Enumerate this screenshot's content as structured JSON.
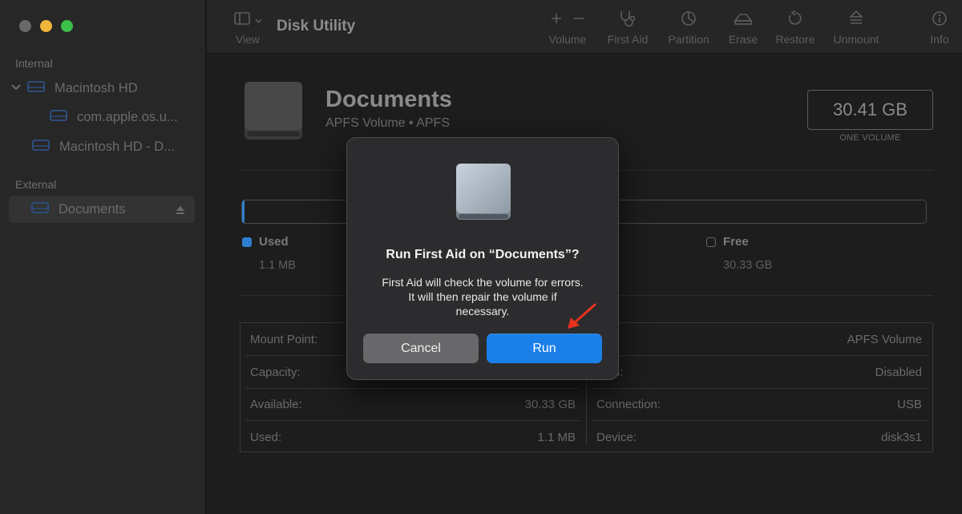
{
  "app": {
    "title": "Disk Utility"
  },
  "sidebar": {
    "sections": [
      {
        "label": "Internal"
      },
      {
        "label": "External"
      }
    ],
    "items": [
      {
        "label": "Macintosh HD"
      },
      {
        "label": "com.apple.os.u..."
      },
      {
        "label": "Macintosh HD - D..."
      },
      {
        "label": "Documents"
      }
    ]
  },
  "toolbar": {
    "view": "View",
    "volume": "Volume",
    "first_aid": "First Aid",
    "partition": "Partition",
    "erase": "Erase",
    "restore": "Restore",
    "unmount": "Unmount",
    "info": "Info"
  },
  "volume": {
    "name": "Documents",
    "subtitle": "APFS Volume • APFS",
    "size": "30.41 GB",
    "size_caption": "ONE VOLUME"
  },
  "usage": {
    "used_fraction": 0.0004,
    "used": {
      "label": "Used",
      "value": "1.1 MB"
    },
    "free": {
      "label": "Free",
      "value": "30.33 GB"
    }
  },
  "info": {
    "left": [
      {
        "k": "Mount Point:",
        "v": ""
      },
      {
        "k": "Capacity:",
        "v": ""
      },
      {
        "k": "Available:",
        "v": "30.33 GB"
      },
      {
        "k": "Used:",
        "v": "1.1 MB"
      }
    ],
    "right": [
      {
        "k": "e:",
        "v": "APFS Volume"
      },
      {
        "k": "ners:",
        "v": "Disabled"
      },
      {
        "k": "Connection:",
        "v": "USB"
      },
      {
        "k": "Device:",
        "v": "disk3s1"
      }
    ]
  },
  "dialog": {
    "title": "Run First Aid on “Documents”?",
    "message_lines": [
      "First Aid will check the volume for errors.",
      "It will then repair the volume if",
      "necessary."
    ],
    "cancel": "Cancel",
    "run": "Run"
  },
  "colors": {
    "accent": "#1b7fe8",
    "annotation_arrow": "#e8321e",
    "used_swatch": "#2f7fd0"
  }
}
